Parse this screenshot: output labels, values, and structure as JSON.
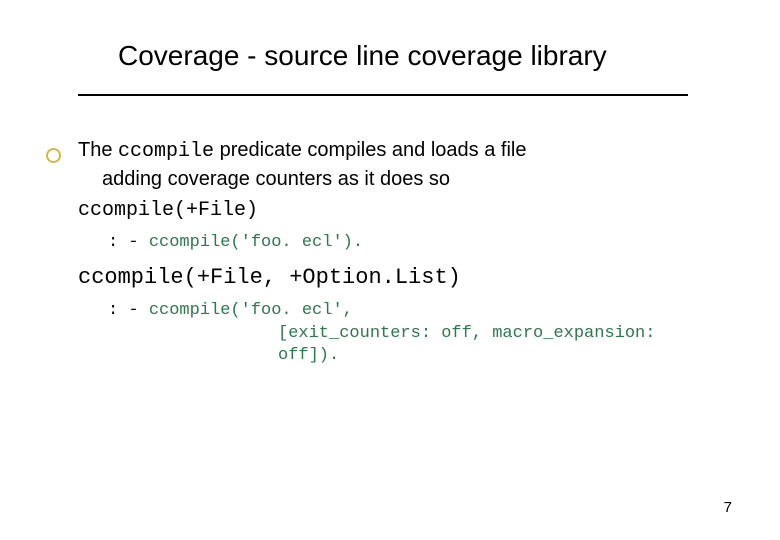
{
  "title": "Coverage - source line coverage library",
  "para": {
    "lead": "The ",
    "code1": "ccompile",
    "mid": " predicate compiles and loads a file",
    "cont": "adding coverage counters as it does so"
  },
  "sig1": "ccompile(+File)",
  "ex1": {
    "col": ": - ",
    "code": "ccompile('foo. ecl')."
  },
  "sig2": "ccompile(+File, +Option.List)",
  "ex2": {
    "col": ": - ",
    "line1": "ccompile('foo. ecl',",
    "line2": "[exit_counters: off, macro_expansion: off])."
  },
  "page": "7"
}
